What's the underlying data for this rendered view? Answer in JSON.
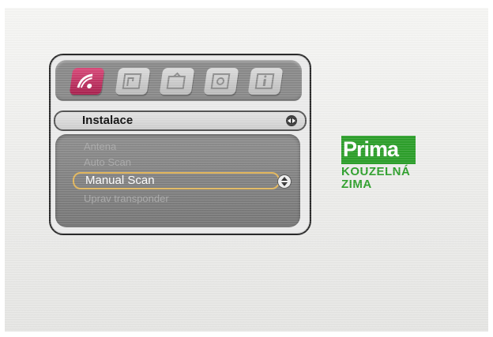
{
  "menu": {
    "tabs": [
      {
        "icon": "satellite-dish-icon",
        "active": true
      },
      {
        "icon": "channel-list-icon",
        "active": false
      },
      {
        "icon": "tv-icon",
        "active": false
      },
      {
        "icon": "settings-icon",
        "active": false
      },
      {
        "icon": "info-icon",
        "active": false
      }
    ],
    "section_title": "Instalace",
    "items": [
      {
        "label": "Antena"
      },
      {
        "label": "Auto Scan"
      },
      {
        "label": "Manual Scan",
        "selected": true
      },
      {
        "label": "Uprav transponder"
      }
    ]
  },
  "channel_logo": {
    "brand": "Prima",
    "line1": "KOUZELNÁ",
    "line2": "ZIMA",
    "color": "#2d9f2b"
  },
  "colors": {
    "active_tab": "#c0306a",
    "selection_border": "#e3b75c"
  }
}
